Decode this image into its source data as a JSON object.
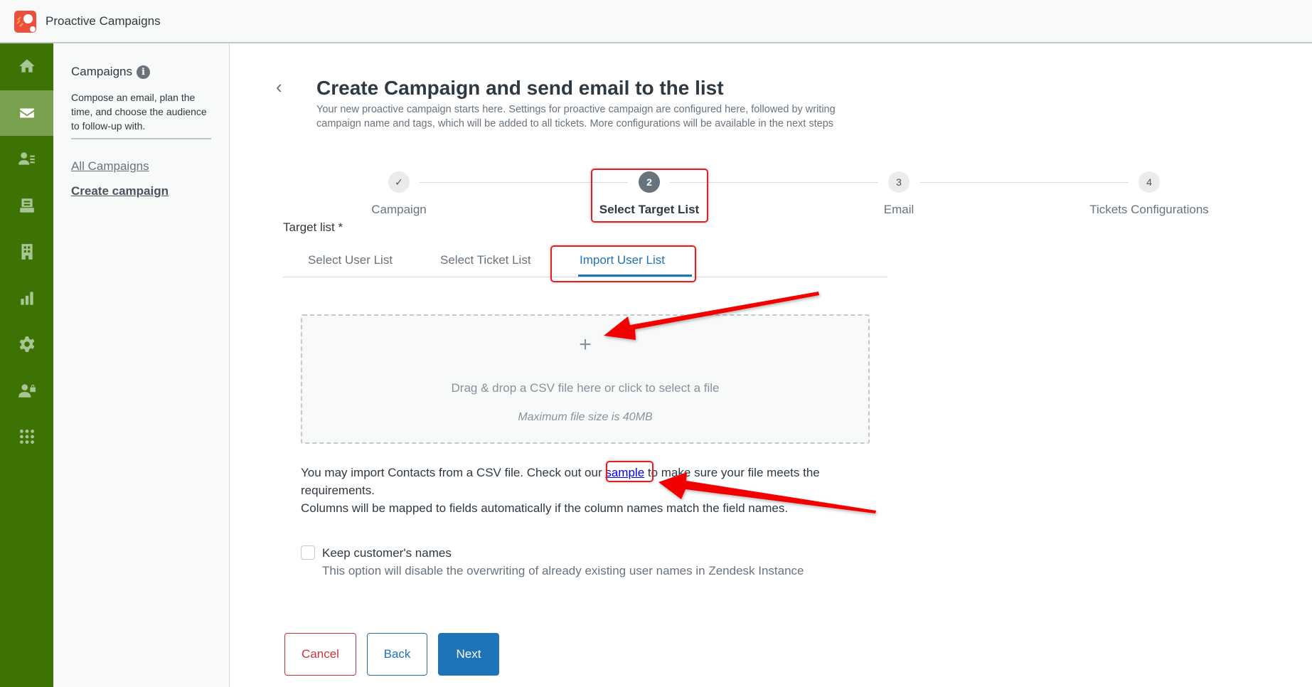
{
  "app": {
    "title": "Proactive Campaigns",
    "logo_icon": "proactive-campaigns-logo"
  },
  "rail": {
    "items": [
      {
        "name": "home",
        "icon": "home-icon",
        "active": false
      },
      {
        "name": "campaigns",
        "icon": "mail-icon",
        "active": true
      },
      {
        "name": "user-lists",
        "icon": "user-list-icon",
        "active": false
      },
      {
        "name": "ticket-lists",
        "icon": "inbox-icon",
        "active": false
      },
      {
        "name": "organizations",
        "icon": "building-icon",
        "active": false
      },
      {
        "name": "reports",
        "icon": "bar-chart-icon",
        "active": false
      },
      {
        "name": "settings",
        "icon": "gear-icon",
        "active": false
      },
      {
        "name": "user-permissions",
        "icon": "user-lock-icon",
        "active": false
      },
      {
        "name": "apps",
        "icon": "grid-icon",
        "active": false
      }
    ]
  },
  "subnav": {
    "title": "Campaigns",
    "info_icon": "i",
    "description": "Compose an email, plan the time, and choose the audience to follow-up with.",
    "links": [
      {
        "label": "All Campaigns",
        "current": false
      },
      {
        "label": "Create campaign",
        "current": true
      }
    ]
  },
  "page": {
    "back_icon": "‹",
    "title": "Create Campaign and send email to the list",
    "description": "Your new proactive campaign starts here. Settings for proactive campaign are configured here, followed by writing campaign name and tags, which will be added to all tickets. More configurations will be available in the next steps"
  },
  "stepper": {
    "steps": [
      {
        "marker": "✓",
        "label": "Campaign",
        "state": "completed"
      },
      {
        "marker": "2",
        "label": "Select Target List",
        "state": "active"
      },
      {
        "marker": "3",
        "label": "Email",
        "state": "pending"
      },
      {
        "marker": "4",
        "label": "Tickets Configurations",
        "state": "pending"
      }
    ]
  },
  "target_list": {
    "label": "Target list *",
    "tabs": [
      {
        "label": "Select User List",
        "active": false
      },
      {
        "label": "Select Ticket List",
        "active": false
      },
      {
        "label": "Import User List",
        "active": true
      }
    ]
  },
  "dropzone": {
    "plus_icon": "+",
    "text": "Drag & drop a CSV file here or click to select a file",
    "hint": "Maximum file size is 40MB"
  },
  "import_info": {
    "before_link": "You may import Contacts from a CSV file. Check out our ",
    "link_label": "sample",
    "after_link": " to make sure your file meets the requirements.",
    "line2": "Columns will be mapped to fields automatically if the column names match the field names."
  },
  "keep_names": {
    "checked": false,
    "label": "Keep customer's names",
    "hint": "This option will disable the overwriting of already existing user names in Zendesk Instance"
  },
  "buttons": {
    "cancel": "Cancel",
    "back": "Back",
    "next": "Next"
  },
  "colors": {
    "rail_bg": "#3d7305",
    "rail_active": "#78a04f",
    "primary": "#1f73b7",
    "danger": "#cc3340",
    "annotation": "#e02020"
  }
}
